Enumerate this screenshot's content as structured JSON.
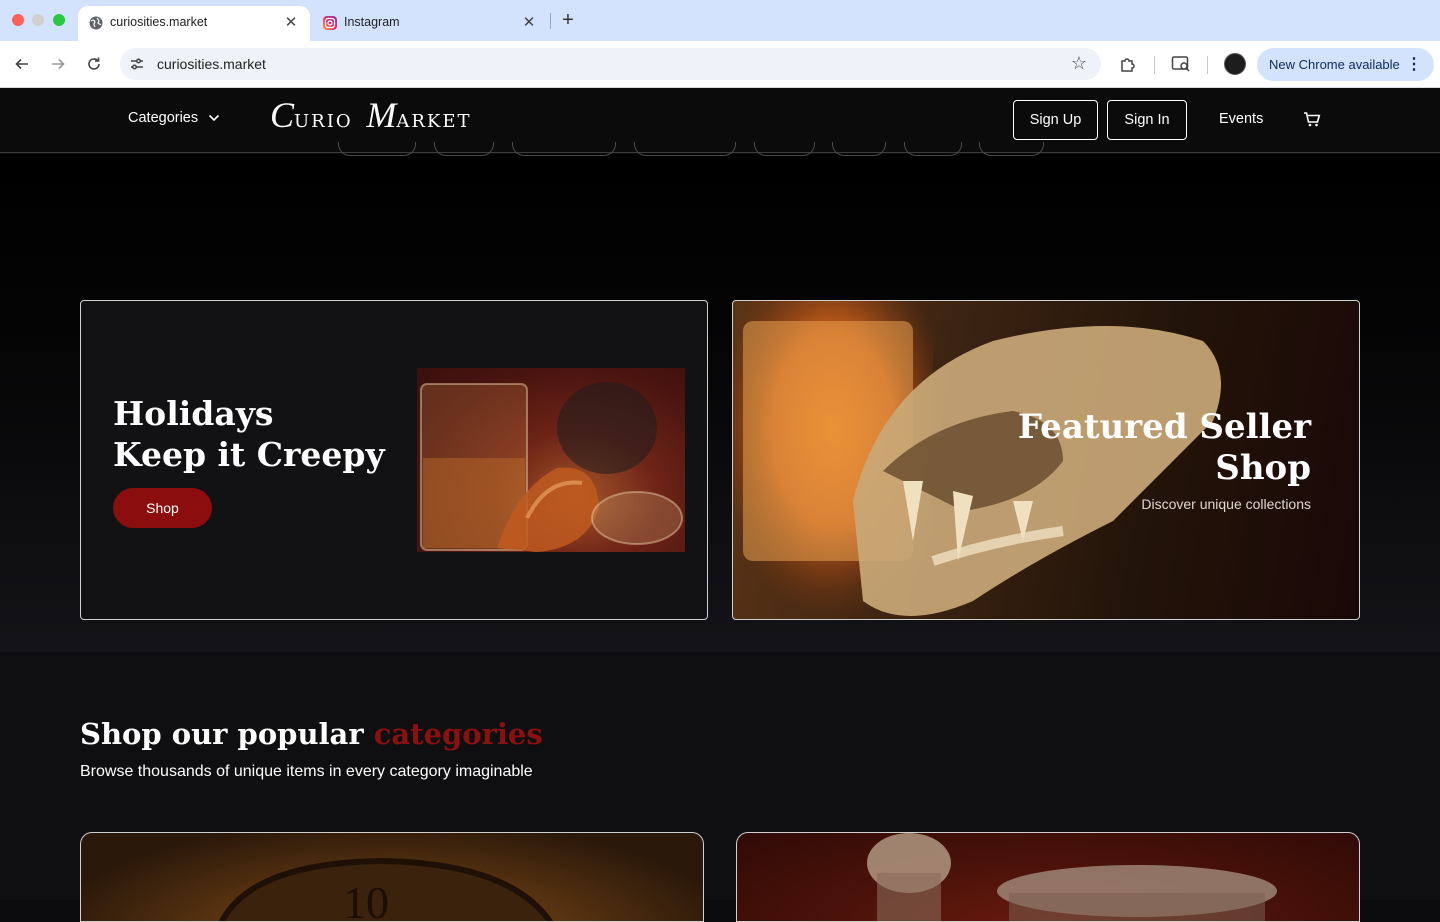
{
  "browser": {
    "tabs": [
      {
        "title": "curiosities.market",
        "favicon": "globe-icon"
      },
      {
        "title": "Instagram",
        "favicon": "instagram-icon"
      }
    ],
    "url": "curiosities.market",
    "update_label": "New Chrome available"
  },
  "header": {
    "categories_label": "Categories",
    "logo_first_initial": "C",
    "logo_first_rest": "URIO",
    "logo_second_initial": "M",
    "logo_second_rest": "ARKET",
    "signup_label": "Sign Up",
    "signin_label": "Sign In",
    "events_label": "Events"
  },
  "hero": {
    "holiday": {
      "title_line1": "Holidays",
      "title_line2": "Keep it Creepy",
      "button_label": "Shop"
    },
    "featured": {
      "title_line1": "Featured Seller",
      "title_line2": "Shop",
      "subtitle": "Discover unique collections"
    }
  },
  "categories_section": {
    "heading_prefix": "Shop our popular ",
    "heading_accent": "categories",
    "subheading": "Browse thousands of unique items in every category imaginable"
  },
  "colors": {
    "accent_red": "#8b0d0d",
    "header_bg": "#0b0b0b",
    "chrome_tabstrip": "#d3e3fd"
  }
}
